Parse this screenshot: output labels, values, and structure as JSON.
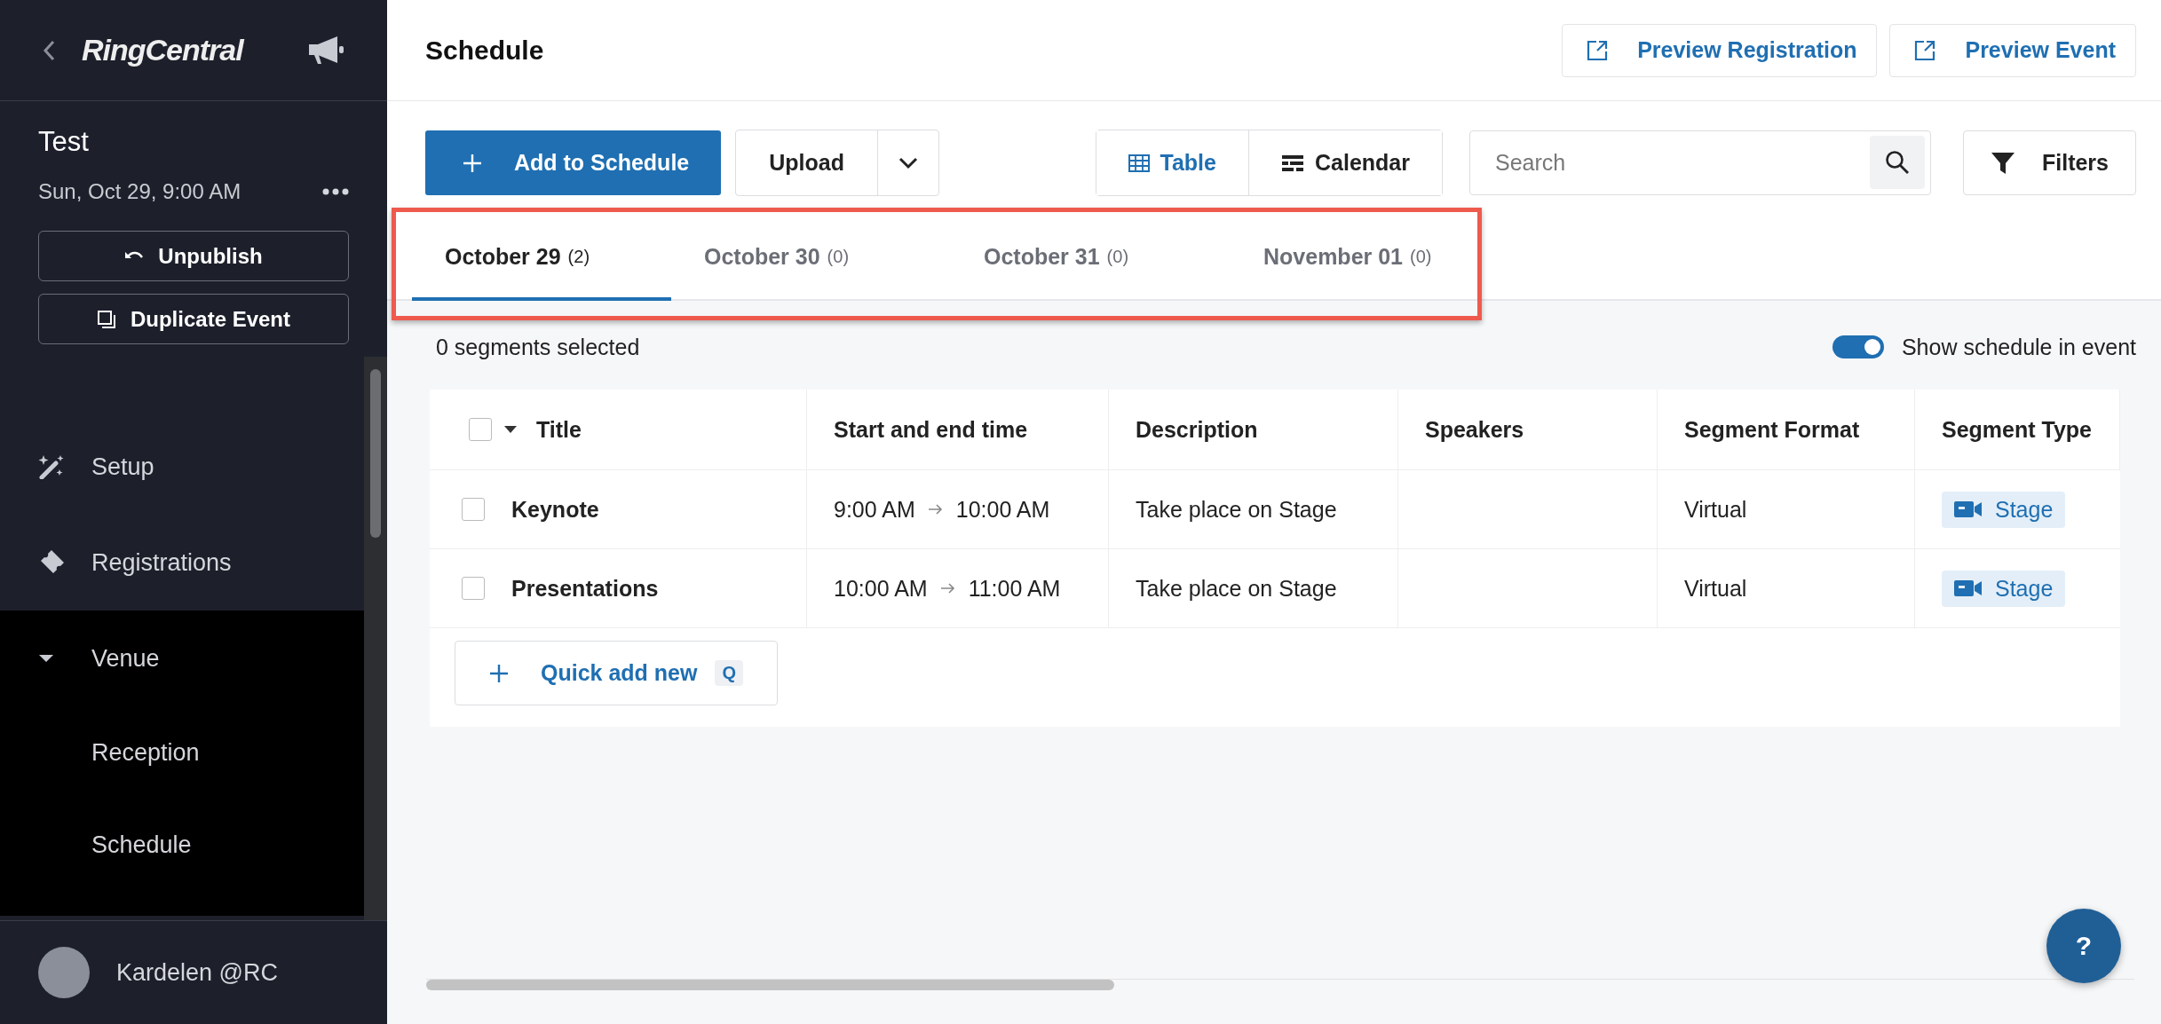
{
  "sidebar": {
    "logo": "RingCentral",
    "event": {
      "title": "Test",
      "date": "Sun, Oct 29, 9:00 AM"
    },
    "actions": [
      {
        "label": "Unpublish",
        "kind": "undo"
      },
      {
        "label": "Duplicate Event",
        "kind": "copy"
      }
    ],
    "nav": [
      {
        "label": "Setup",
        "kind": "wand"
      },
      {
        "label": "Registrations",
        "kind": "ticket"
      },
      {
        "label": "Venue",
        "kind": "group",
        "expanded": true,
        "children": [
          {
            "label": "Reception"
          },
          {
            "label": "Schedule"
          }
        ]
      }
    ],
    "user": {
      "name": "Kardelen @RC"
    }
  },
  "main": {
    "title": "Schedule",
    "header_buttons": [
      "Preview Registration",
      "Preview Event"
    ],
    "toolbar": {
      "add_button": "Add to Schedule",
      "upload_button": "Upload",
      "views": [
        {
          "label": "Table",
          "kind": "table",
          "selected": true
        },
        {
          "label": "Calendar",
          "kind": "calendar",
          "selected": false
        }
      ],
      "search": {
        "placeholder": "Search"
      },
      "filters_button": "Filters"
    },
    "date_tabs": [
      {
        "label": "October 29",
        "count": "(2)",
        "selected": true
      },
      {
        "label": "October 30",
        "count": "(0)",
        "selected": false
      },
      {
        "label": "October 31",
        "count": "(0)",
        "selected": false
      },
      {
        "label": "November 01",
        "count": "(0)",
        "selected": false
      }
    ],
    "selection_count": "0 segments selected",
    "show_toggle": {
      "label": "Show schedule in event",
      "on": true
    },
    "table": {
      "select_all_checked": false,
      "columns": [
        "Title",
        "Start and end time",
        "Description",
        "Speakers",
        "Segment Format",
        "Segment Type"
      ],
      "rows": [
        {
          "checked": false,
          "title": "Keynote",
          "start": "9:00 AM",
          "end": "10:00 AM",
          "description": "Take place on Stage",
          "format": "Virtual",
          "type": "Stage"
        },
        {
          "checked": false,
          "title": "Presentations",
          "start": "10:00 AM",
          "end": "11:00 AM",
          "description": "Take place on Stage",
          "format": "Virtual",
          "type": "Stage"
        }
      ],
      "quick_add": {
        "label": "Quick add new",
        "shortcut": "Q"
      }
    },
    "help_button": "?"
  }
}
